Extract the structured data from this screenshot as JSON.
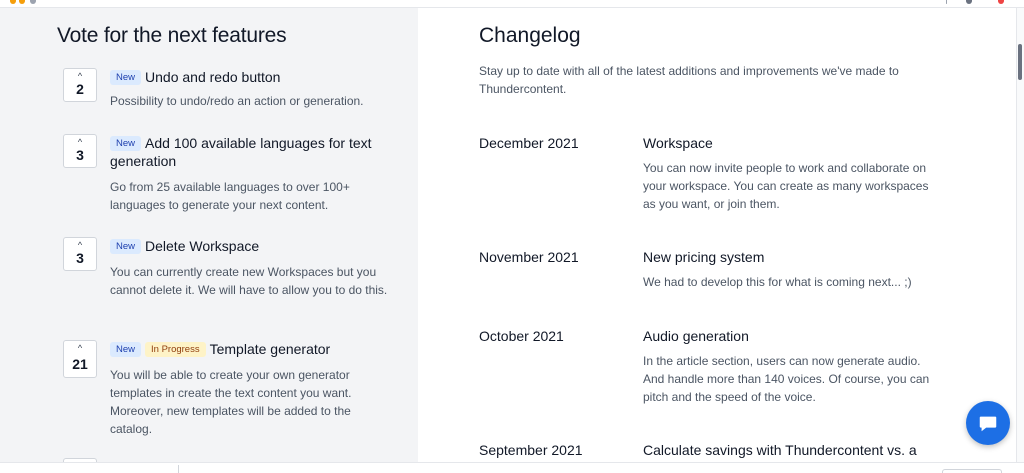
{
  "votes": {
    "title": "Vote for the next features",
    "items": [
      {
        "count": "2",
        "badges": [
          "New"
        ],
        "title": "Undo and redo button",
        "description": "Possibility to undo/redo an action or generation."
      },
      {
        "count": "3",
        "badges": [
          "New"
        ],
        "title": "Add 100 available languages for text generation",
        "description": "Go from 25 available languages to over 100+ languages to generate your next content."
      },
      {
        "count": "3",
        "badges": [
          "New"
        ],
        "title": "Delete Workspace",
        "description": "You can currently create new Workspaces but you cannot delete it. We will have to allow you to do this."
      },
      {
        "count": "21",
        "badges": [
          "New",
          "In Progress"
        ],
        "title": "Template generator",
        "description": "You will be able to create your own generator templates in create the text content you want. Moreover, new templates will be added to the catalog."
      }
    ]
  },
  "changelog": {
    "title": "Changelog",
    "intro": "Stay up to date with all of the latest additions and improvements we've made to Thundercontent.",
    "entries": [
      {
        "date": "December 2021",
        "title": "Workspace",
        "description": "You can now invite people to work and collaborate on your workspace. You can create as many workspaces as you want, or join them."
      },
      {
        "date": "November 2021",
        "title": "New pricing system",
        "description": "We had to develop this for what is coming next... ;)"
      },
      {
        "date": "October 2021",
        "title": "Audio generation",
        "description": "In the article section, users can now generate audio. And handle more than 140 voices. Of course, you can pitch and the speed of the voice."
      },
      {
        "date": "September 2021",
        "title": "Calculate savings with Thundercontent vs. a",
        "description": ""
      }
    ]
  },
  "icons": {
    "upvote": "chevron-up-icon",
    "chat": "chat-bubble-icon"
  },
  "colors": {
    "badge_new_bg": "#dbeafe",
    "badge_new_text": "#1e40af",
    "badge_progress_bg": "#fef3c7",
    "badge_progress_text": "#92400e",
    "chat_button": "#1d6fe5",
    "left_panel_bg": "#f3f4f6"
  }
}
